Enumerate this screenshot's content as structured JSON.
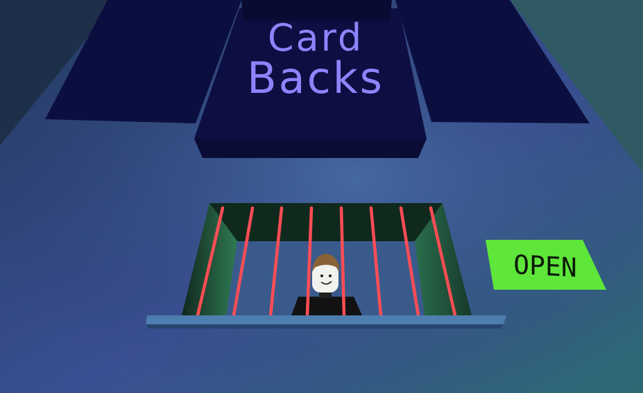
{
  "sign": {
    "line1": "Card",
    "line2": "Backs"
  },
  "door_button": {
    "label": "OPEN"
  },
  "colors": {
    "floor": "#35509a",
    "sign_panel": "#0d0f42",
    "sign_text": "#8d84ff",
    "laser": "#ff4d55",
    "open_button": "#5ee63a"
  },
  "icons": {
    "player": "roblox-avatar-icon"
  }
}
